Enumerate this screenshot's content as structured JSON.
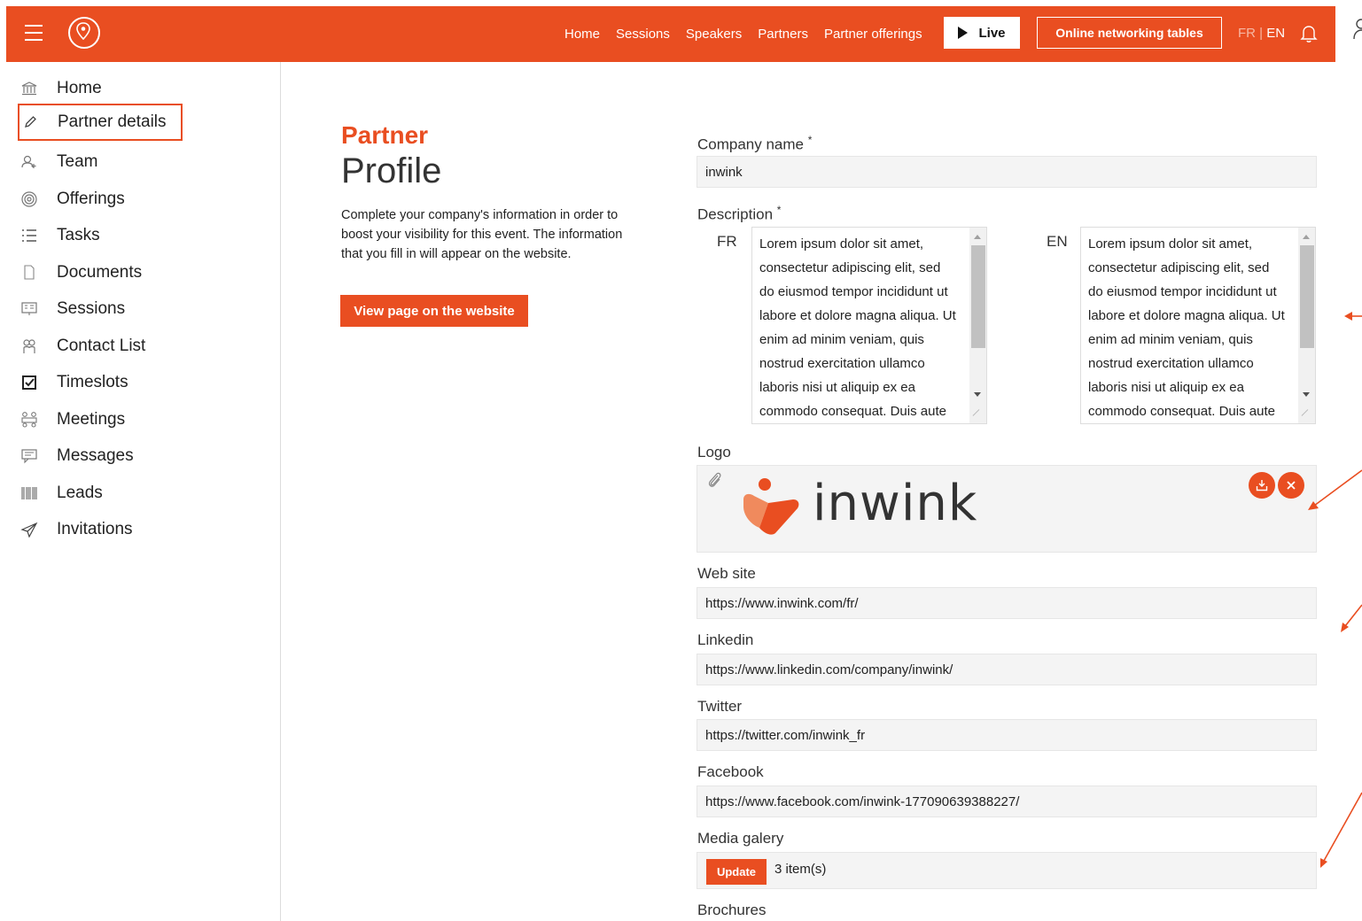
{
  "topbar": {
    "nav": [
      "Home",
      "Sessions",
      "Speakers",
      "Partners",
      "Partner offerings"
    ],
    "live_label": "Live",
    "networking_label": "Online networking tables",
    "lang_fr": "FR",
    "lang_sep": " | ",
    "lang_en": "EN",
    "accent": "#e94e21"
  },
  "sidebar": {
    "items": [
      {
        "label": "Home",
        "icon": "bank-icon"
      },
      {
        "label": "Partner details",
        "icon": "pencil-icon"
      },
      {
        "label": "Team",
        "icon": "team-icon"
      },
      {
        "label": "Offerings",
        "icon": "target-icon"
      },
      {
        "label": "Tasks",
        "icon": "checklist-icon"
      },
      {
        "label": "Documents",
        "icon": "document-icon"
      },
      {
        "label": "Sessions",
        "icon": "presentation-icon"
      },
      {
        "label": "Contact List",
        "icon": "contacts-icon"
      },
      {
        "label": "Timeslots",
        "icon": "checkbox-icon"
      },
      {
        "label": "Meetings",
        "icon": "meeting-icon"
      },
      {
        "label": "Messages",
        "icon": "chat-icon"
      },
      {
        "label": "Leads",
        "icon": "barcode-icon"
      },
      {
        "label": "Invitations",
        "icon": "paper-plane-icon"
      }
    ],
    "active_index": 1
  },
  "intro": {
    "title_1": "Partner",
    "title_2": "Profile",
    "description": "Complete your company's information in order to boost your visibility for this event. The information that you fill in will appear on the website.",
    "view_button": "View page on the website"
  },
  "form": {
    "company_name": {
      "label": "Company name",
      "required": "*",
      "value": "inwink"
    },
    "description": {
      "label": "Description",
      "required": "*",
      "fr_label": "FR",
      "en_label": "EN",
      "fr_lines": [
        "Lorem ipsum dolor sit amet,",
        "consectetur adipiscing elit, sed",
        "do eiusmod tempor incididunt ut",
        "labore et dolore magna aliqua. Ut",
        "enim ad minim veniam, quis",
        "nostrud exercitation ullamco",
        "laboris nisi ut aliquip ex ea",
        "commodo consequat. Duis aute"
      ],
      "en_lines": [
        "Lorem ipsum dolor sit amet,",
        "consectetur adipiscing elit, sed",
        "do eiusmod tempor incididunt ut",
        "labore et dolore magna aliqua. Ut",
        "enim ad minim veniam, quis",
        "nostrud exercitation ullamco",
        "laboris nisi ut aliquip ex ea",
        "commodo consequat. Duis aute"
      ]
    },
    "logo": {
      "label": "Logo",
      "wordmark": "inwink"
    },
    "website": {
      "label": "Web site",
      "value": "https://www.inwink.com/fr/"
    },
    "linkedin": {
      "label": "Linkedin",
      "value": "https://www.linkedin.com/company/inwink/"
    },
    "twitter": {
      "label": "Twitter",
      "value": "https://twitter.com/inwink_fr"
    },
    "facebook": {
      "label": "Facebook",
      "value": "https://www.facebook.com/inwink-177090639388227/"
    },
    "media": {
      "label": "Media galery",
      "update_label": "Update",
      "count": "3 item(s)"
    },
    "brochures": {
      "label": "Brochures"
    }
  }
}
